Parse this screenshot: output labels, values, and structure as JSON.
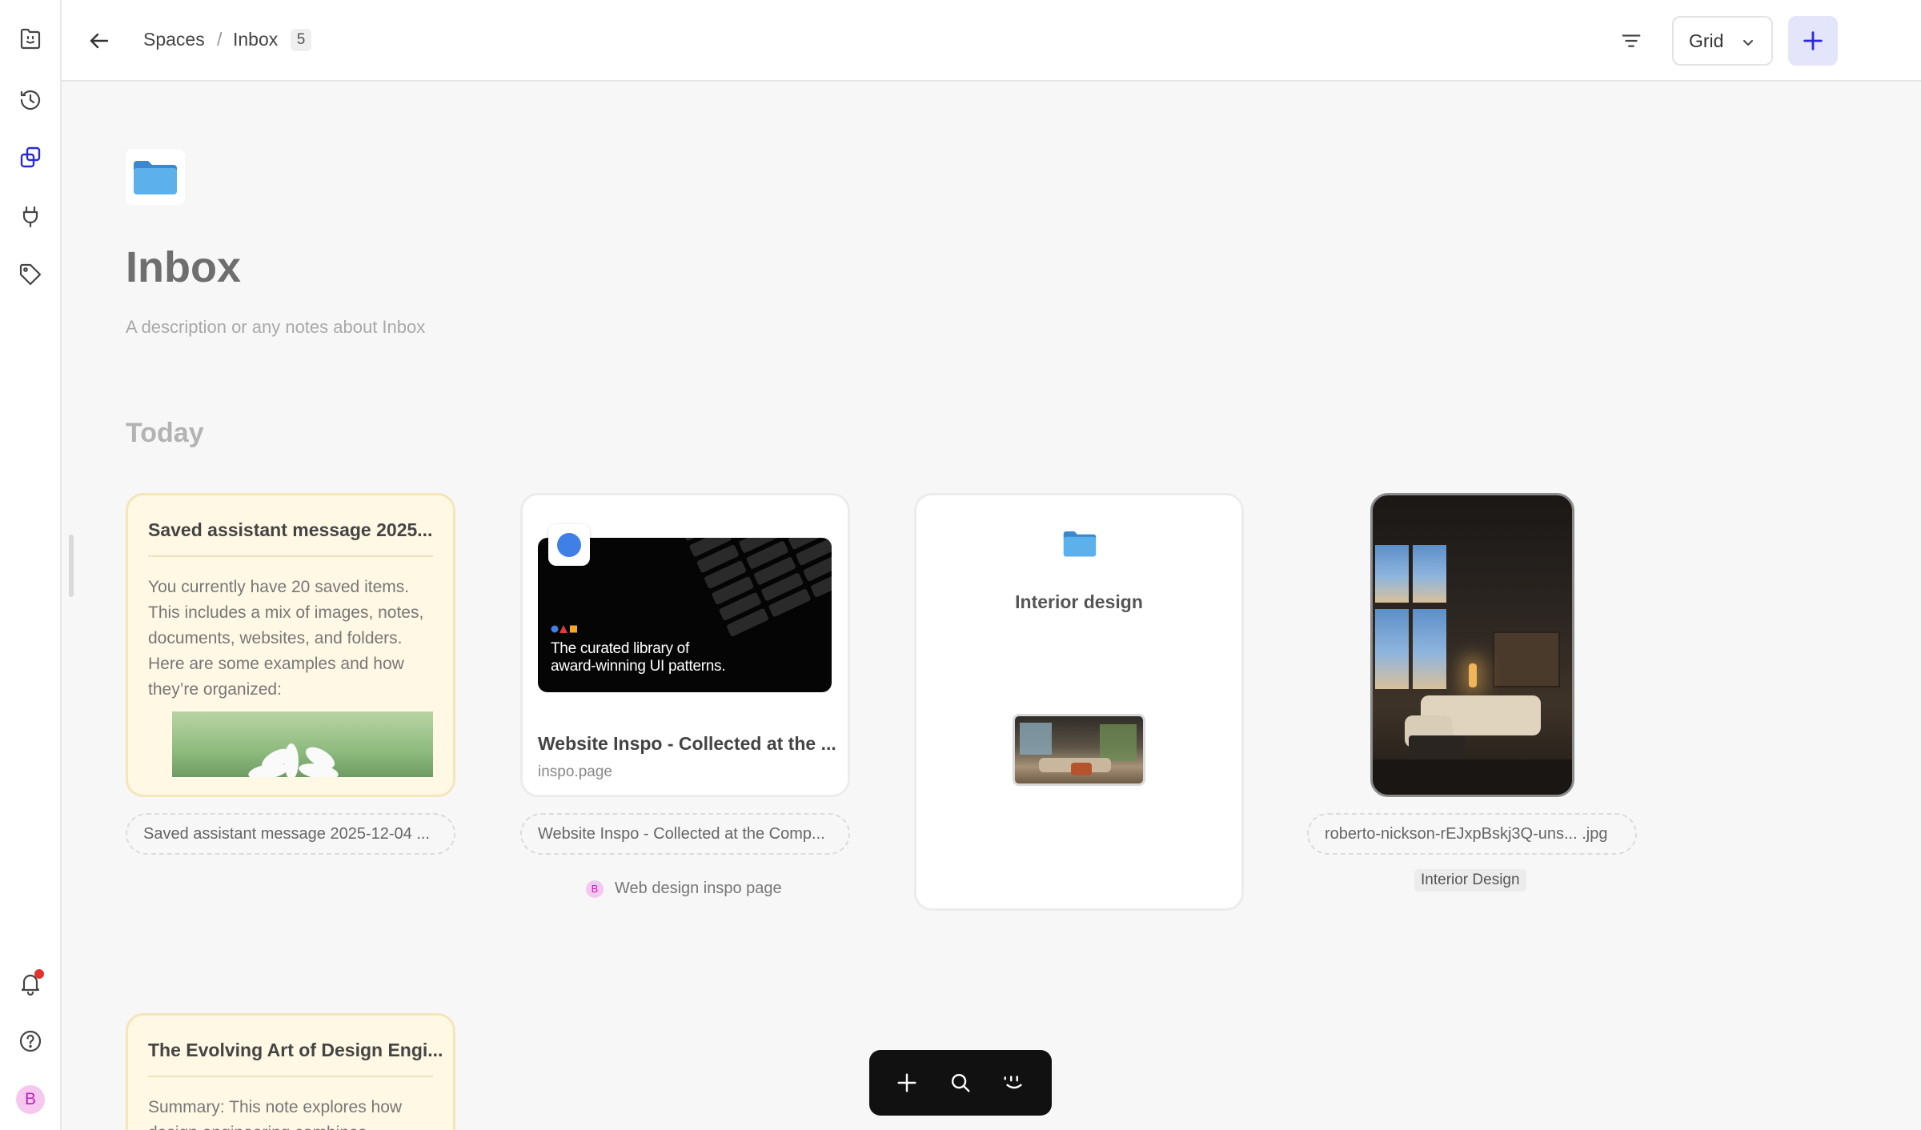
{
  "topbar": {
    "crumbs": [
      "Spaces",
      "Inbox"
    ],
    "separator": "/",
    "count": "5",
    "view": "Grid"
  },
  "header": {
    "title": "Inbox",
    "description": "A description or any notes about Inbox"
  },
  "section": "Today",
  "cards": [
    {
      "type": "note",
      "title": "Saved assistant message 2025...",
      "body": "You currently have 20 saved items. This includes a mix of images, notes, documents, websites, and folders. Here are some examples and how they’re organized:",
      "label": "Saved assistant message 2025-12-04 ..."
    },
    {
      "type": "website",
      "title": "Website Inspo - Collected at the ...",
      "domain": "inspo.page",
      "thumb_text": "The curated library of award-winning UI patterns.",
      "label": "Website Inspo - Collected at the Comp...",
      "tag_avatar": "B",
      "tag": "Web design inspo page"
    },
    {
      "type": "folder",
      "title": "Interior design"
    },
    {
      "type": "image",
      "label": "roberto-nickson-rEJxpBskj3Q-uns... .jpg",
      "tag": "Interior Design"
    },
    {
      "type": "note",
      "title": "The Evolving Art of Design Engi...",
      "body": "Summary: This note explores how design engineering combines"
    }
  ],
  "sidebar": {
    "avatar": "B"
  },
  "colors": {
    "accent": "#2b2bd6",
    "add_bg": "#e4e4fb",
    "note_bg": "#fff8e4",
    "notification": "#e5322d",
    "folder": "#4da3e6"
  },
  "icons": {
    "sidebar": [
      "smile-box-icon",
      "history-icon",
      "spaces-icon",
      "plug-icon",
      "tag-icon",
      "bell-icon",
      "help-icon"
    ],
    "toolbar": [
      "plus-icon",
      "search-icon",
      "smile-icon"
    ]
  }
}
